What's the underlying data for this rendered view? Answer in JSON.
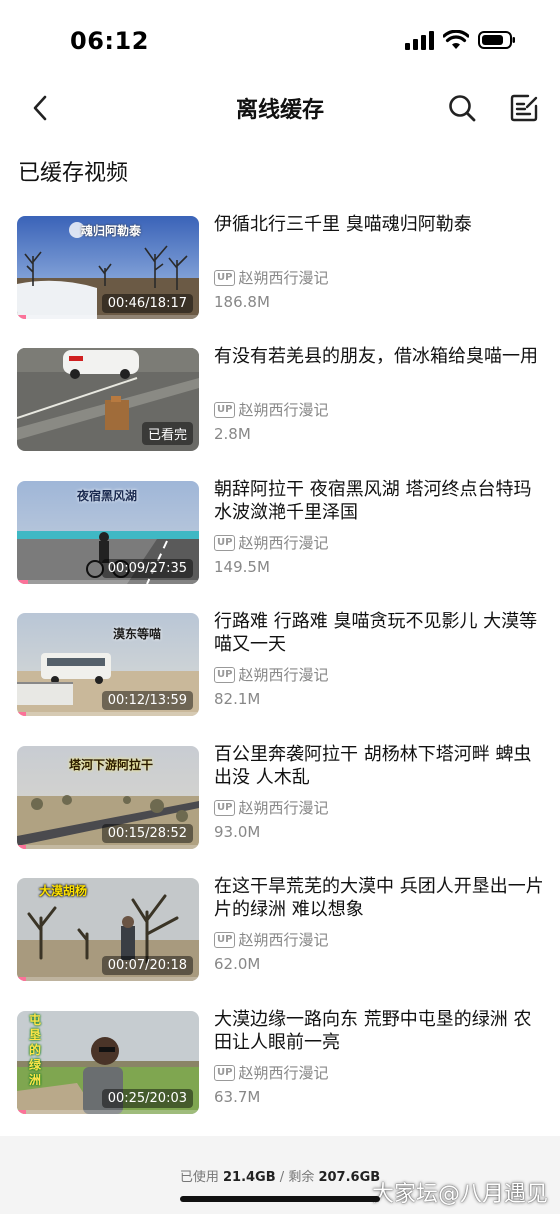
{
  "status": {
    "time": "06:12"
  },
  "nav": {
    "title": "离线缓存",
    "back_icon": "chevron-left-icon",
    "search_icon": "search-icon",
    "edit_icon": "edit-icon"
  },
  "section_title": "已缓存视频",
  "up_badge": "UP",
  "videos": [
    {
      "title": "伊循北行三千里 臭喵魂归阿勒泰",
      "thumb_title": "魂归阿勒泰",
      "duration": "00:46/18:17",
      "uploader": "赵朔西行漫记",
      "size": "186.8M",
      "progress": 0.05
    },
    {
      "title": "有没有若羌县的朋友，借冰箱给臭喵一用",
      "thumb_title": "",
      "duration": "已看完",
      "uploader": "赵朔西行漫记",
      "size": "2.8M",
      "progress": 1.0
    },
    {
      "title": "朝辞阿拉干 夜宿黑风湖 塔河终点台特玛 水波潋滟千里泽国",
      "thumb_title": "夜宿黑风湖",
      "duration": "00:09/27:35",
      "uploader": "赵朔西行漫记",
      "size": "149.5M",
      "progress": 0.06
    },
    {
      "title": "行路难 行路难 臭喵贪玩不见影儿 大漠等喵又一天",
      "thumb_title": "漠东等喵",
      "duration": "00:12/13:59",
      "uploader": "赵朔西行漫记",
      "size": "82.1M",
      "progress": 0.05
    },
    {
      "title": "百公里奔袭阿拉干 胡杨林下塔河畔 蜱虫出没 人木乱",
      "thumb_title": "塔河下游阿拉干",
      "duration": "00:15/28:52",
      "uploader": "赵朔西行漫记",
      "size": "93.0M",
      "progress": 0.05
    },
    {
      "title": "在这干旱荒芜的大漠中 兵团人开垦出一片片的绿洲 难以想象",
      "thumb_title": "大漠胡杨",
      "duration": "00:07/20:18",
      "uploader": "赵朔西行漫记",
      "size": "62.0M",
      "progress": 0.05
    },
    {
      "title": "大漠边缘一路向东 荒野中屯垦的绿洲 农田让人眼前一亮",
      "thumb_title": "屯垦的绿洲",
      "duration": "00:25/20:03",
      "uploader": "赵朔西行漫记",
      "size": "63.7M",
      "progress": 0.05
    }
  ],
  "storage": {
    "used_label": "已使用",
    "used": "21.4GB",
    "separator": "/",
    "free_label": "剩余",
    "free": "207.6GB"
  },
  "watermark": "大家坛@八月遇见",
  "colors": {
    "accent": "#fb7299",
    "text": "#111111",
    "secondary": "#888888",
    "footer_bg": "#f4f4f4"
  }
}
